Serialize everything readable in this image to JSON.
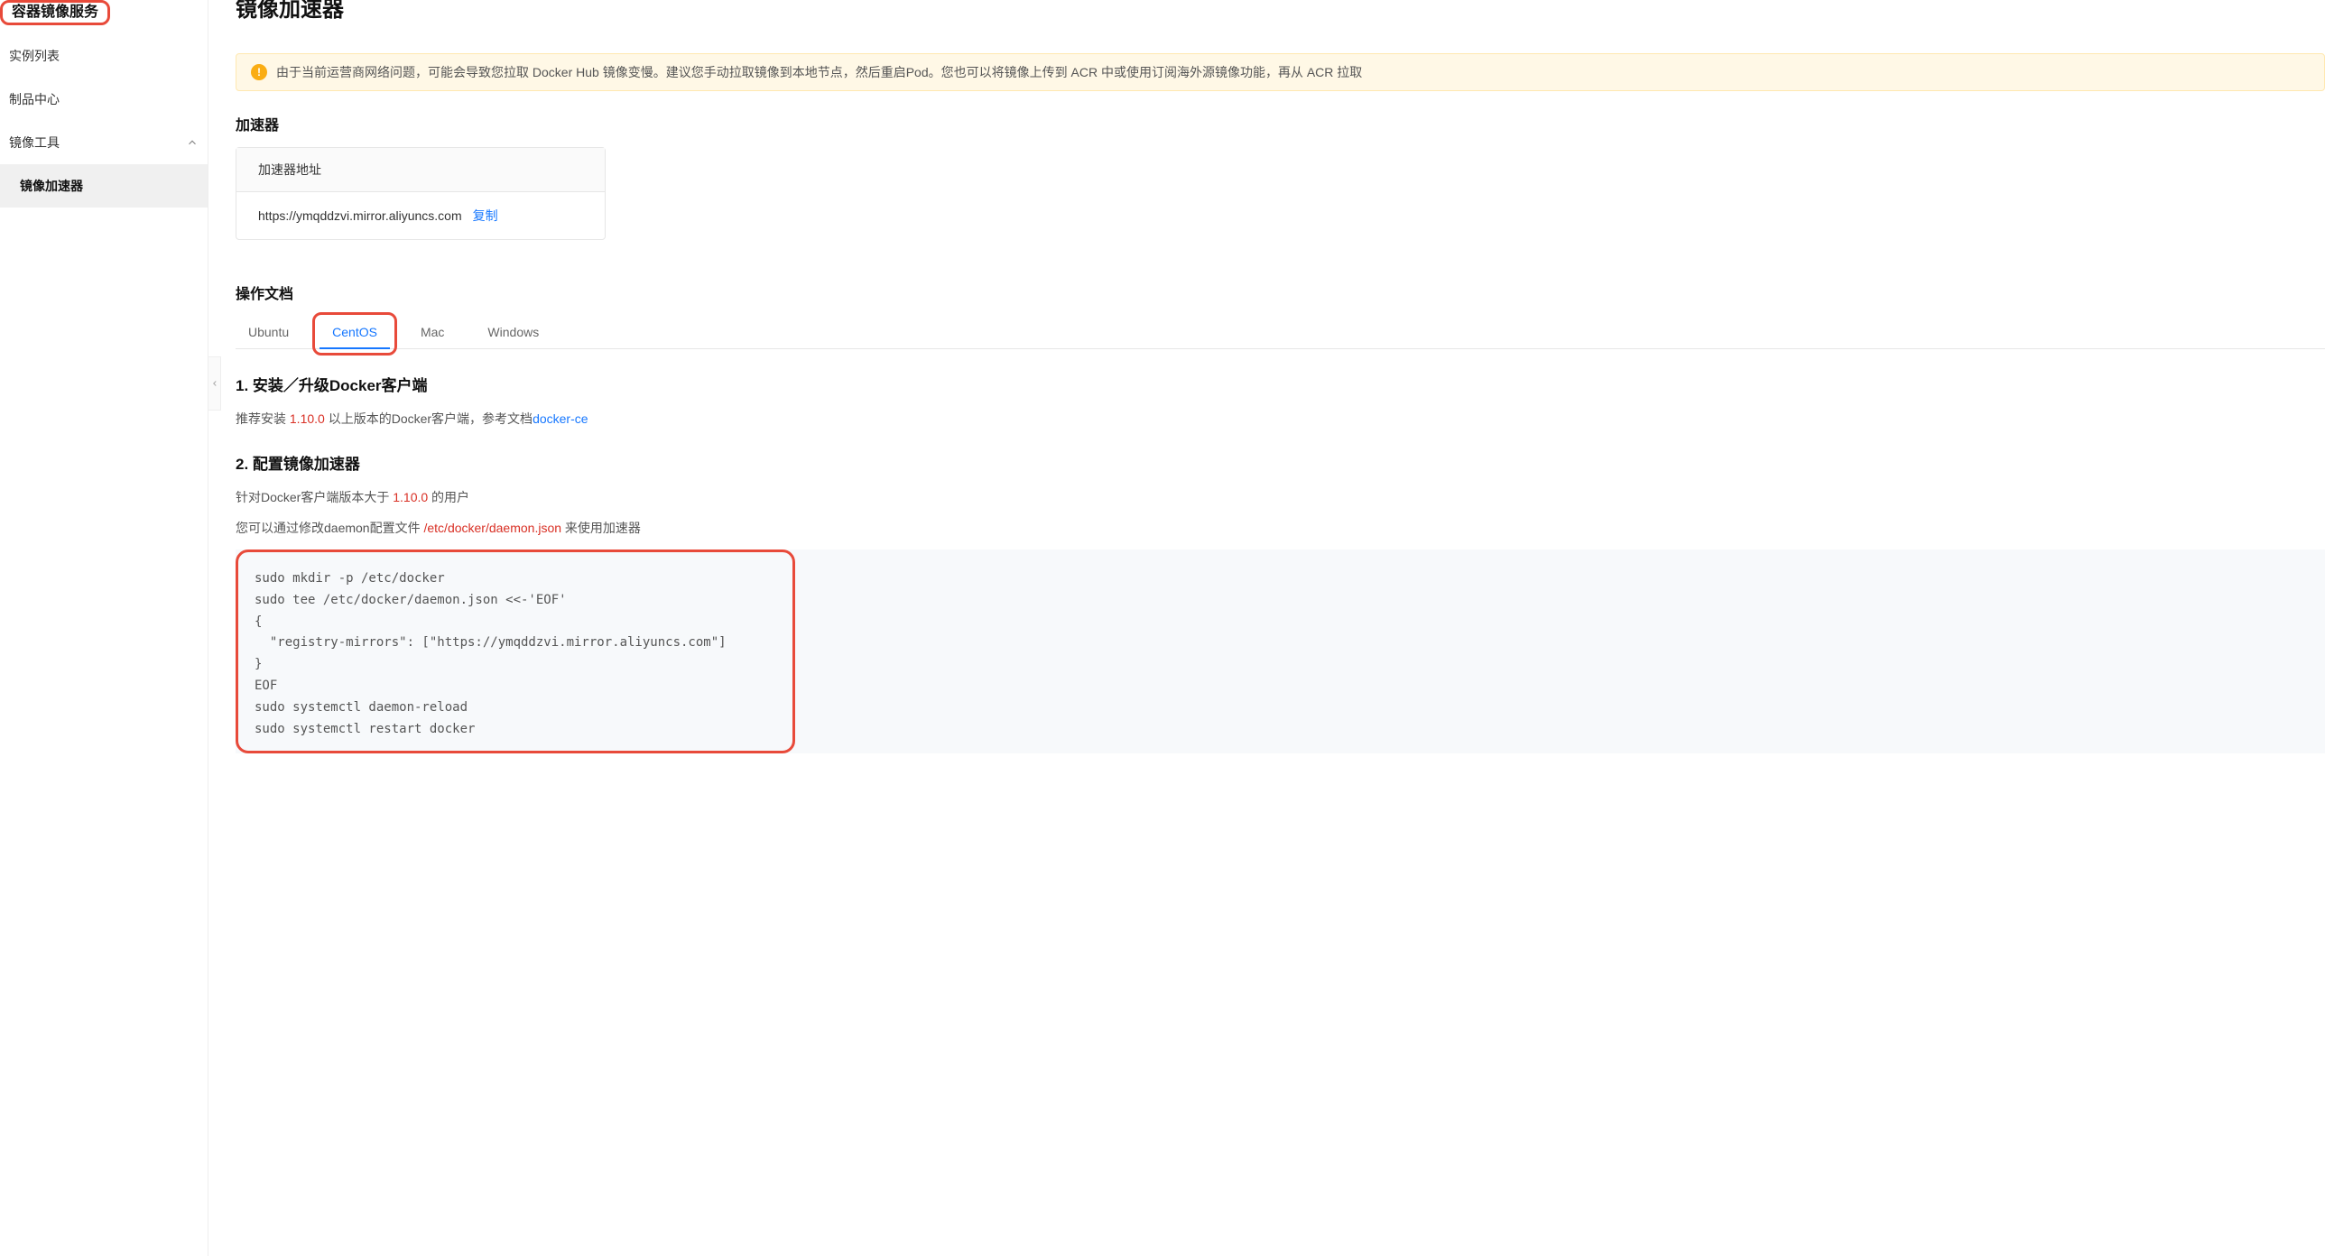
{
  "sidebar": {
    "title": "容器镜像服务",
    "items": [
      {
        "label": "实例列表"
      },
      {
        "label": "制品中心"
      },
      {
        "label": "镜像工具",
        "expandable": true,
        "expanded": true
      }
    ],
    "subitem": {
      "label": "镜像加速器"
    }
  },
  "page": {
    "title": "镜像加速器"
  },
  "alert": {
    "text": "由于当前运营商网络问题，可能会导致您拉取 Docker Hub 镜像变慢。建议您手动拉取镜像到本地节点，然后重启Pod。您也可以将镜像上传到 ACR 中或使用订阅海外源镜像功能，再从 ACR 拉取"
  },
  "accelerator": {
    "heading": "加速器",
    "card_label": "加速器地址",
    "url": "https://ymqddzvi.mirror.aliyuncs.com",
    "copy_label": "复制"
  },
  "docs": {
    "heading": "操作文档",
    "tabs": [
      {
        "label": "Ubuntu",
        "active": false
      },
      {
        "label": "CentOS",
        "active": true
      },
      {
        "label": "Mac",
        "active": false
      },
      {
        "label": "Windows",
        "active": false
      }
    ],
    "section1": {
      "title": "1. 安装／升级Docker客户端",
      "text_before": "推荐安装 ",
      "version": "1.10.0",
      "text_mid": " 以上版本的Docker客户端，参考文档",
      "link": "docker-ce"
    },
    "section2": {
      "title": "2. 配置镜像加速器",
      "line1_before": "针对Docker客户端版本大于 ",
      "line1_version": "1.10.0",
      "line1_after": " 的用户",
      "line2_before": "您可以通过修改daemon配置文件 ",
      "line2_path": "/etc/docker/daemon.json",
      "line2_after": " 来使用加速器",
      "code": "sudo mkdir -p /etc/docker\nsudo tee /etc/docker/daemon.json <<-'EOF'\n{\n  \"registry-mirrors\": [\"https://ymqddzvi.mirror.aliyuncs.com\"]\n}\nEOF\nsudo systemctl daemon-reload\nsudo systemctl restart docker"
    }
  }
}
